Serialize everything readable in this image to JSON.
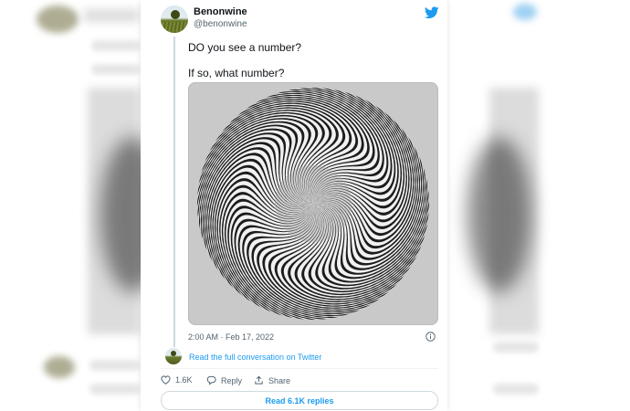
{
  "tweet": {
    "author_name": "Benonwine",
    "author_handle": "@benonwine",
    "text_line_1": "DO you see a number?",
    "text_line_2": "If so, what number?",
    "timestamp": "2:00 AM · Feb 17, 2022",
    "read_conversation": "Read the full conversation on Twitter",
    "likes": "1.6K",
    "reply_label": "Reply",
    "share_label": "Share",
    "read_replies": "Read 6.1K replies"
  },
  "icons": {
    "brand": "twitter-bird-icon",
    "info": "info-icon",
    "like": "heart-icon",
    "reply": "speech-bubble-icon",
    "share": "share-icon"
  },
  "colors": {
    "accent": "#1d9bf0",
    "text": "#0f1419",
    "muted": "#536471",
    "media_background": "#c9c9c9"
  }
}
